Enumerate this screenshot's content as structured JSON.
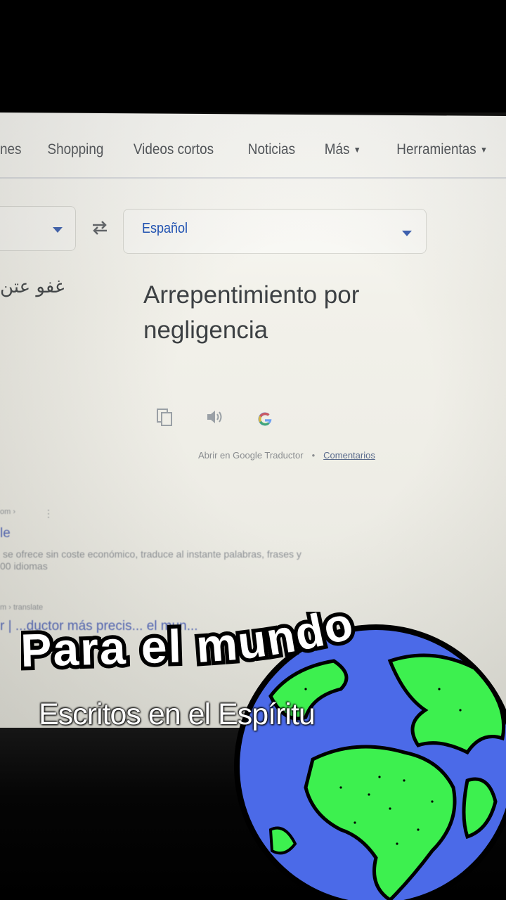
{
  "nav": {
    "items": [
      "nes",
      "Shopping",
      "Videos cortos",
      "Noticias",
      "Más",
      "Herramientas"
    ]
  },
  "translator": {
    "target_language": "Español",
    "source_text": "غفو عتن",
    "translated_text": "Arrepentimiento por negligencia",
    "open_link": "Abrir en Google Traductor",
    "separator": "•",
    "feedback_link": "Comentarios"
  },
  "results": {
    "meta_1": "om ›",
    "title_1": "le",
    "snippet_1a": "se ofrece sin coste económico, traduce al instante palabras, frases y",
    "snippet_1b": "00 idiomas",
    "meta_2": "m › translate",
    "title_2": "r | ...ductor más precis... el mun..."
  },
  "overlay": {
    "title": "Para el mundo",
    "subtitle": "Escritos en el Espíritu"
  },
  "colors": {
    "link_blue": "#1a4fb5",
    "text_gray": "#4d5156",
    "globe_ocean": "#4b6ae8",
    "globe_land": "#3df04f"
  }
}
